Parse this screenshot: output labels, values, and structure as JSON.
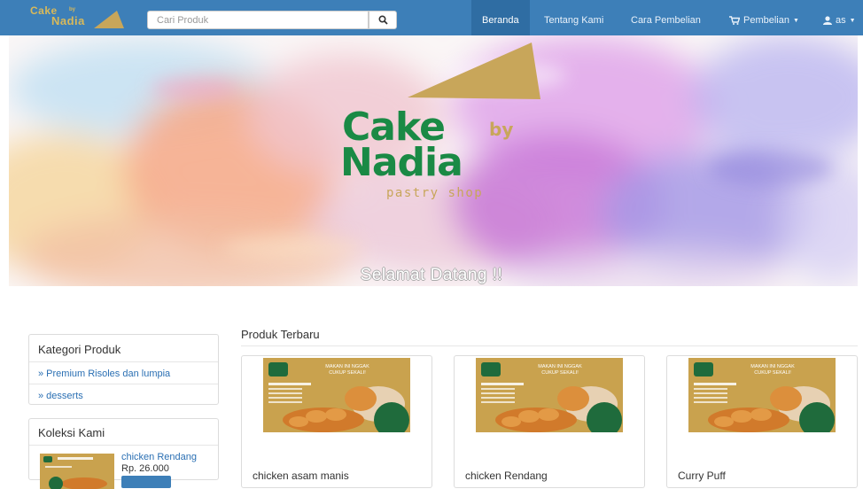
{
  "brand": {
    "line1": "Cake",
    "by": "by",
    "line2": "Nadia"
  },
  "search": {
    "placeholder": "Cari Produk"
  },
  "nav": {
    "home": "Beranda",
    "about": "Tentang Kami",
    "how_to_buy": "Cara Pembelian",
    "purchase": "Pembelian",
    "user": "as"
  },
  "hero": {
    "logo_line1": "Cake",
    "logo_by": "by",
    "logo_line2": "Nadia",
    "logo_tagline": "pastry shop",
    "welcome": "Selamat Datang !!"
  },
  "sidebar": {
    "categories_title": "Kategori Produk",
    "categories": [
      {
        "label": "» Premium Risoles dan lumpia"
      },
      {
        "label": "» desserts"
      }
    ],
    "collection_title": "Koleksi Kami",
    "collection": [
      {
        "name": "chicken Rendang",
        "price": "Rp. 26.000"
      }
    ]
  },
  "products": {
    "title": "Produk Terbaru",
    "items": [
      {
        "name": "chicken asam manis"
      },
      {
        "name": "chicken Rendang"
      },
      {
        "name": "Curry Puff"
      }
    ]
  },
  "poster": {
    "headline1": "MAKAN INI NGGAK",
    "headline2": "CUKUP SEKALI!"
  },
  "colors": {
    "navbar": "#3d7fb8",
    "navbar_active": "#2f6da3",
    "link": "#2a6fb3",
    "logo_green": "#1a8a45",
    "logo_gold": "#c8a65a",
    "poster_bg": "#c9a24e",
    "poster_green": "#1f6b3c"
  }
}
